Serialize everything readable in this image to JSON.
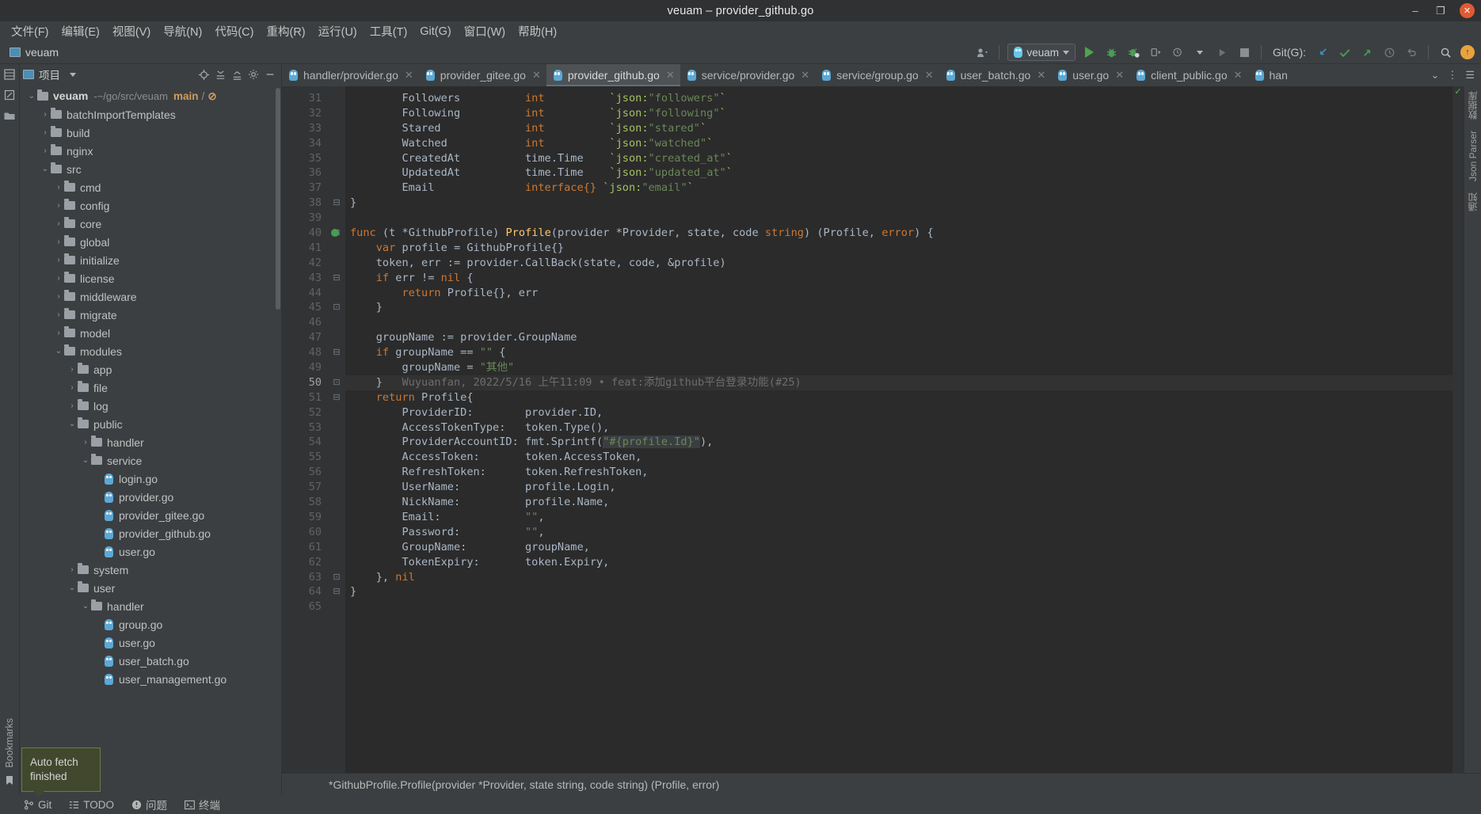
{
  "window": {
    "title": "veuam – provider_github.go",
    "minimize": "–",
    "maximize": "❐",
    "close": "✕"
  },
  "menubar": [
    {
      "label": "文件(F)"
    },
    {
      "label": "编辑(E)"
    },
    {
      "label": "视图(V)"
    },
    {
      "label": "导航(N)"
    },
    {
      "label": "代码(C)"
    },
    {
      "label": "重构(R)"
    },
    {
      "label": "运行(U)"
    },
    {
      "label": "工具(T)"
    },
    {
      "label": "Git(G)"
    },
    {
      "label": "窗口(W)"
    },
    {
      "label": "帮助(H)"
    }
  ],
  "toolbar": {
    "project_name": "veuam",
    "run_config": "veuam",
    "git_label": "Git(G):",
    "icons": [
      "user-avatar-icon",
      "run-icon",
      "debug-icon",
      "run-coverage-icon",
      "profile-icon",
      "history-icon",
      "stop-icon"
    ],
    "git_icons": [
      "update-project-icon",
      "commit-icon",
      "push-icon",
      "history-icon",
      "rollback-icon"
    ],
    "search_icon": "search-icon",
    "update-badge": "↑"
  },
  "project_panel": {
    "title": "项目",
    "tools": [
      "locate-icon",
      "expand-all-icon",
      "collapse-all-icon",
      "settings-icon",
      "hide-icon"
    ],
    "tree": [
      {
        "depth": 0,
        "type": "root",
        "twisty": "⌄",
        "name": "veuam",
        "path": "-~/go/src/veuam",
        "branch": "main",
        "branch_sep": "/",
        "branch_extra": "⊘"
      },
      {
        "depth": 1,
        "type": "folder",
        "twisty": "›",
        "name": "batchImportTemplates"
      },
      {
        "depth": 1,
        "type": "folder",
        "twisty": "›",
        "name": "build"
      },
      {
        "depth": 1,
        "type": "folder",
        "twisty": "›",
        "name": "nginx"
      },
      {
        "depth": 1,
        "type": "folder",
        "twisty": "⌄",
        "name": "src"
      },
      {
        "depth": 2,
        "type": "folder",
        "twisty": "›",
        "name": "cmd"
      },
      {
        "depth": 2,
        "type": "folder",
        "twisty": "›",
        "name": "config"
      },
      {
        "depth": 2,
        "type": "folder",
        "twisty": "›",
        "name": "core"
      },
      {
        "depth": 2,
        "type": "folder",
        "twisty": "›",
        "name": "global"
      },
      {
        "depth": 2,
        "type": "folder",
        "twisty": "›",
        "name": "initialize"
      },
      {
        "depth": 2,
        "type": "folder",
        "twisty": "›",
        "name": "license"
      },
      {
        "depth": 2,
        "type": "folder",
        "twisty": "›",
        "name": "middleware"
      },
      {
        "depth": 2,
        "type": "folder",
        "twisty": "›",
        "name": "migrate"
      },
      {
        "depth": 2,
        "type": "folder",
        "twisty": "›",
        "name": "model"
      },
      {
        "depth": 2,
        "type": "folder",
        "twisty": "⌄",
        "name": "modules"
      },
      {
        "depth": 3,
        "type": "folder",
        "twisty": "›",
        "name": "app"
      },
      {
        "depth": 3,
        "type": "folder",
        "twisty": "›",
        "name": "file"
      },
      {
        "depth": 3,
        "type": "folder",
        "twisty": "›",
        "name": "log"
      },
      {
        "depth": 3,
        "type": "folder",
        "twisty": "⌄",
        "name": "public"
      },
      {
        "depth": 4,
        "type": "folder",
        "twisty": "›",
        "name": "handler"
      },
      {
        "depth": 4,
        "type": "folder",
        "twisty": "⌄",
        "name": "service"
      },
      {
        "depth": 5,
        "type": "gofile",
        "twisty": "",
        "name": "login.go"
      },
      {
        "depth": 5,
        "type": "gofile",
        "twisty": "",
        "name": "provider.go"
      },
      {
        "depth": 5,
        "type": "gofile",
        "twisty": "",
        "name": "provider_gitee.go"
      },
      {
        "depth": 5,
        "type": "gofile",
        "twisty": "",
        "name": "provider_github.go"
      },
      {
        "depth": 5,
        "type": "gofile",
        "twisty": "",
        "name": "user.go"
      },
      {
        "depth": 3,
        "type": "folder",
        "twisty": "›",
        "name": "system"
      },
      {
        "depth": 3,
        "type": "folder",
        "twisty": "⌄",
        "name": "user"
      },
      {
        "depth": 4,
        "type": "folder",
        "twisty": "⌄",
        "name": "handler"
      },
      {
        "depth": 5,
        "type": "gofile",
        "twisty": "",
        "name": "group.go"
      },
      {
        "depth": 5,
        "type": "gofile",
        "twisty": "",
        "name": "user.go"
      },
      {
        "depth": 5,
        "type": "gofile",
        "twisty": "",
        "name": "user_batch.go"
      },
      {
        "depth": 5,
        "type": "gofile",
        "twisty": "",
        "name": "user_management.go"
      }
    ]
  },
  "rails": {
    "left_top_icons": [
      "structure-icon",
      "commit-icon",
      "project-folder-icon"
    ],
    "left_bottom_label": "Bookmarks",
    "right_labels": [
      "数据库",
      "Json Parser",
      "通知"
    ]
  },
  "tabs": [
    {
      "label": "handler/provider.go",
      "active": false
    },
    {
      "label": "provider_gitee.go",
      "active": false
    },
    {
      "label": "provider_github.go",
      "active": true
    },
    {
      "label": "service/provider.go",
      "active": false
    },
    {
      "label": "service/group.go",
      "active": false
    },
    {
      "label": "user_batch.go",
      "active": false
    },
    {
      "label": "user.go",
      "active": false
    },
    {
      "label": "client_public.go",
      "active": false
    },
    {
      "label": "han",
      "active": false
    }
  ],
  "editor": {
    "first_line": 31,
    "lines": [
      {
        "n": 31,
        "fold": "",
        "tokens": [
          {
            "t": "        ",
            "c": "plain"
          },
          {
            "t": "Followers",
            "c": "plain"
          },
          {
            "t": "          ",
            "c": "plain"
          },
          {
            "t": "int",
            "c": "kw"
          },
          {
            "t": "          ",
            "c": "plain"
          },
          {
            "t": "`json:",
            "c": "tag"
          },
          {
            "t": "\"followers\"",
            "c": "str"
          },
          {
            "t": "`",
            "c": "tag"
          }
        ]
      },
      {
        "n": 32,
        "fold": "",
        "tokens": [
          {
            "t": "        ",
            "c": "plain"
          },
          {
            "t": "Following",
            "c": "plain"
          },
          {
            "t": "          ",
            "c": "plain"
          },
          {
            "t": "int",
            "c": "kw"
          },
          {
            "t": "          ",
            "c": "plain"
          },
          {
            "t": "`json:",
            "c": "tag"
          },
          {
            "t": "\"following\"",
            "c": "str"
          },
          {
            "t": "`",
            "c": "tag"
          }
        ]
      },
      {
        "n": 33,
        "fold": "",
        "tokens": [
          {
            "t": "        ",
            "c": "plain"
          },
          {
            "t": "Stared",
            "c": "plain"
          },
          {
            "t": "             ",
            "c": "plain"
          },
          {
            "t": "int",
            "c": "kw"
          },
          {
            "t": "          ",
            "c": "plain"
          },
          {
            "t": "`json:",
            "c": "tag"
          },
          {
            "t": "\"stared\"",
            "c": "str"
          },
          {
            "t": "`",
            "c": "tag"
          }
        ]
      },
      {
        "n": 34,
        "fold": "",
        "tokens": [
          {
            "t": "        ",
            "c": "plain"
          },
          {
            "t": "Watched",
            "c": "plain"
          },
          {
            "t": "            ",
            "c": "plain"
          },
          {
            "t": "int",
            "c": "kw"
          },
          {
            "t": "          ",
            "c": "plain"
          },
          {
            "t": "`json:",
            "c": "tag"
          },
          {
            "t": "\"watched\"",
            "c": "str"
          },
          {
            "t": "`",
            "c": "tag"
          }
        ]
      },
      {
        "n": 35,
        "fold": "",
        "tokens": [
          {
            "t": "        ",
            "c": "plain"
          },
          {
            "t": "CreatedAt",
            "c": "plain"
          },
          {
            "t": "          ",
            "c": "plain"
          },
          {
            "t": "time.Time",
            "c": "pkg"
          },
          {
            "t": "    ",
            "c": "plain"
          },
          {
            "t": "`json:",
            "c": "tag"
          },
          {
            "t": "\"created_at\"",
            "c": "str"
          },
          {
            "t": "`",
            "c": "tag"
          }
        ]
      },
      {
        "n": 36,
        "fold": "",
        "tokens": [
          {
            "t": "        ",
            "c": "plain"
          },
          {
            "t": "UpdatedAt",
            "c": "plain"
          },
          {
            "t": "          ",
            "c": "plain"
          },
          {
            "t": "time.Time",
            "c": "pkg"
          },
          {
            "t": "    ",
            "c": "plain"
          },
          {
            "t": "`json:",
            "c": "tag"
          },
          {
            "t": "\"updated_at\"",
            "c": "str"
          },
          {
            "t": "`",
            "c": "tag"
          }
        ]
      },
      {
        "n": 37,
        "fold": "",
        "tokens": [
          {
            "t": "        ",
            "c": "plain"
          },
          {
            "t": "Email",
            "c": "plain"
          },
          {
            "t": "              ",
            "c": "plain"
          },
          {
            "t": "interface{}",
            "c": "kw"
          },
          {
            "t": " ",
            "c": "plain"
          },
          {
            "t": "`json:",
            "c": "tag"
          },
          {
            "t": "\"email\"",
            "c": "str"
          },
          {
            "t": "`",
            "c": "tag"
          }
        ]
      },
      {
        "n": 38,
        "fold": "⊟",
        "tokens": [
          {
            "t": "}",
            "c": "plain"
          }
        ]
      },
      {
        "n": 39,
        "fold": "",
        "tokens": []
      },
      {
        "n": 40,
        "fold": "⊟",
        "gutter_marker": "run-gutter-icon",
        "tokens": [
          {
            "t": "func",
            "c": "kw"
          },
          {
            "t": " (t ",
            "c": "plain"
          },
          {
            "t": "*",
            "c": "plain"
          },
          {
            "t": "GithubProfile",
            "c": "plain"
          },
          {
            "t": ") ",
            "c": "plain"
          },
          {
            "t": "Profile",
            "c": "fn"
          },
          {
            "t": "(provider ",
            "c": "plain"
          },
          {
            "t": "*",
            "c": "plain"
          },
          {
            "t": "Provider",
            "c": "plain"
          },
          {
            "t": ", state, code ",
            "c": "plain"
          },
          {
            "t": "string",
            "c": "kw"
          },
          {
            "t": ") (Profile, ",
            "c": "plain"
          },
          {
            "t": "error",
            "c": "kw"
          },
          {
            "t": ") {",
            "c": "plain"
          }
        ]
      },
      {
        "n": 41,
        "fold": "",
        "tokens": [
          {
            "t": "    ",
            "c": "plain"
          },
          {
            "t": "var",
            "c": "kw"
          },
          {
            "t": " profile = GithubProfile{}",
            "c": "plain"
          }
        ]
      },
      {
        "n": 42,
        "fold": "",
        "tokens": [
          {
            "t": "    token, err := provider.CallBack(state, code, &profile)",
            "c": "plain"
          }
        ]
      },
      {
        "n": 43,
        "fold": "⊟",
        "tokens": [
          {
            "t": "    ",
            "c": "plain"
          },
          {
            "t": "if",
            "c": "kw"
          },
          {
            "t": " err != ",
            "c": "plain"
          },
          {
            "t": "nil",
            "c": "kw"
          },
          {
            "t": " {",
            "c": "plain"
          }
        ]
      },
      {
        "n": 44,
        "fold": "",
        "tokens": [
          {
            "t": "        ",
            "c": "plain"
          },
          {
            "t": "return",
            "c": "kw"
          },
          {
            "t": " Profile{}, err",
            "c": "plain"
          }
        ]
      },
      {
        "n": 45,
        "fold": "⊡",
        "tokens": [
          {
            "t": "    }",
            "c": "plain"
          }
        ]
      },
      {
        "n": 46,
        "fold": "",
        "tokens": []
      },
      {
        "n": 47,
        "fold": "",
        "tokens": [
          {
            "t": "    groupName := provider.GroupName",
            "c": "plain"
          }
        ]
      },
      {
        "n": 48,
        "fold": "⊟",
        "tokens": [
          {
            "t": "    ",
            "c": "plain"
          },
          {
            "t": "if",
            "c": "kw"
          },
          {
            "t": " groupName == ",
            "c": "plain"
          },
          {
            "t": "\"\"",
            "c": "str"
          },
          {
            "t": " {",
            "c": "plain"
          }
        ]
      },
      {
        "n": 49,
        "fold": "",
        "tokens": [
          {
            "t": "        groupName = ",
            "c": "plain"
          },
          {
            "t": "\"其他\"",
            "c": "str"
          }
        ]
      },
      {
        "n": 50,
        "fold": "⊡",
        "current": true,
        "tokens": [
          {
            "t": "    }",
            "c": "plain"
          },
          {
            "t": "   Wuyuanfan, 2022/5/16 上午11:09 • feat:添加github平台登录功能(#25)",
            "c": "blame"
          }
        ]
      },
      {
        "n": 51,
        "fold": "⊟",
        "tokens": [
          {
            "t": "    ",
            "c": "plain"
          },
          {
            "t": "return",
            "c": "kw"
          },
          {
            "t": " Profile{",
            "c": "plain"
          }
        ]
      },
      {
        "n": 52,
        "fold": "",
        "tokens": [
          {
            "t": "        ProviderID:        provider.ID,",
            "c": "plain"
          }
        ]
      },
      {
        "n": 53,
        "fold": "",
        "tokens": [
          {
            "t": "        AccessTokenType:   token.Type(),",
            "c": "plain"
          }
        ]
      },
      {
        "n": 54,
        "fold": "",
        "tokens": [
          {
            "t": "        ProviderAccountID: fmt.Sprintf(",
            "c": "plain"
          },
          {
            "t": "\"#{profile.Id}\"",
            "c": "str-hl"
          },
          {
            "t": "),",
            "c": "plain"
          }
        ]
      },
      {
        "n": 55,
        "fold": "",
        "tokens": [
          {
            "t": "        AccessToken:       token.AccessToken,",
            "c": "plain"
          }
        ]
      },
      {
        "n": 56,
        "fold": "",
        "tokens": [
          {
            "t": "        RefreshToken:      token.RefreshToken,",
            "c": "plain"
          }
        ]
      },
      {
        "n": 57,
        "fold": "",
        "tokens": [
          {
            "t": "        UserName:          profile.Login,",
            "c": "plain"
          }
        ]
      },
      {
        "n": 58,
        "fold": "",
        "tokens": [
          {
            "t": "        NickName:          profile.Name,",
            "c": "plain"
          }
        ]
      },
      {
        "n": 59,
        "fold": "",
        "tokens": [
          {
            "t": "        Email:             ",
            "c": "plain"
          },
          {
            "t": "\"\"",
            "c": "str"
          },
          {
            "t": ",",
            "c": "plain"
          }
        ]
      },
      {
        "n": 60,
        "fold": "",
        "tokens": [
          {
            "t": "        Password:          ",
            "c": "plain"
          },
          {
            "t": "\"\"",
            "c": "str"
          },
          {
            "t": ",",
            "c": "plain"
          }
        ]
      },
      {
        "n": 61,
        "fold": "",
        "tokens": [
          {
            "t": "        GroupName:         groupName,",
            "c": "plain"
          }
        ]
      },
      {
        "n": 62,
        "fold": "",
        "tokens": [
          {
            "t": "        TokenExpiry:       token.Expiry,",
            "c": "plain"
          }
        ]
      },
      {
        "n": 63,
        "fold": "⊡",
        "tokens": [
          {
            "t": "    }, ",
            "c": "plain"
          },
          {
            "t": "nil",
            "c": "kw"
          }
        ]
      },
      {
        "n": 64,
        "fold": "⊟",
        "tokens": [
          {
            "t": "}",
            "c": "plain"
          }
        ]
      },
      {
        "n": 65,
        "fold": "",
        "tokens": []
      }
    ]
  },
  "breadcrumb": "*GithubProfile.Profile(provider *Provider, state string, code string) (Profile, error)",
  "bottom_tools": [
    {
      "icon": "git-branch-icon",
      "label": "Git"
    },
    {
      "icon": "todo-icon",
      "label": "TODO"
    },
    {
      "icon": "problems-icon",
      "label": "问题"
    },
    {
      "icon": "terminal-icon",
      "label": "终端"
    }
  ],
  "tooltip": {
    "text": "Auto fetch finished"
  }
}
